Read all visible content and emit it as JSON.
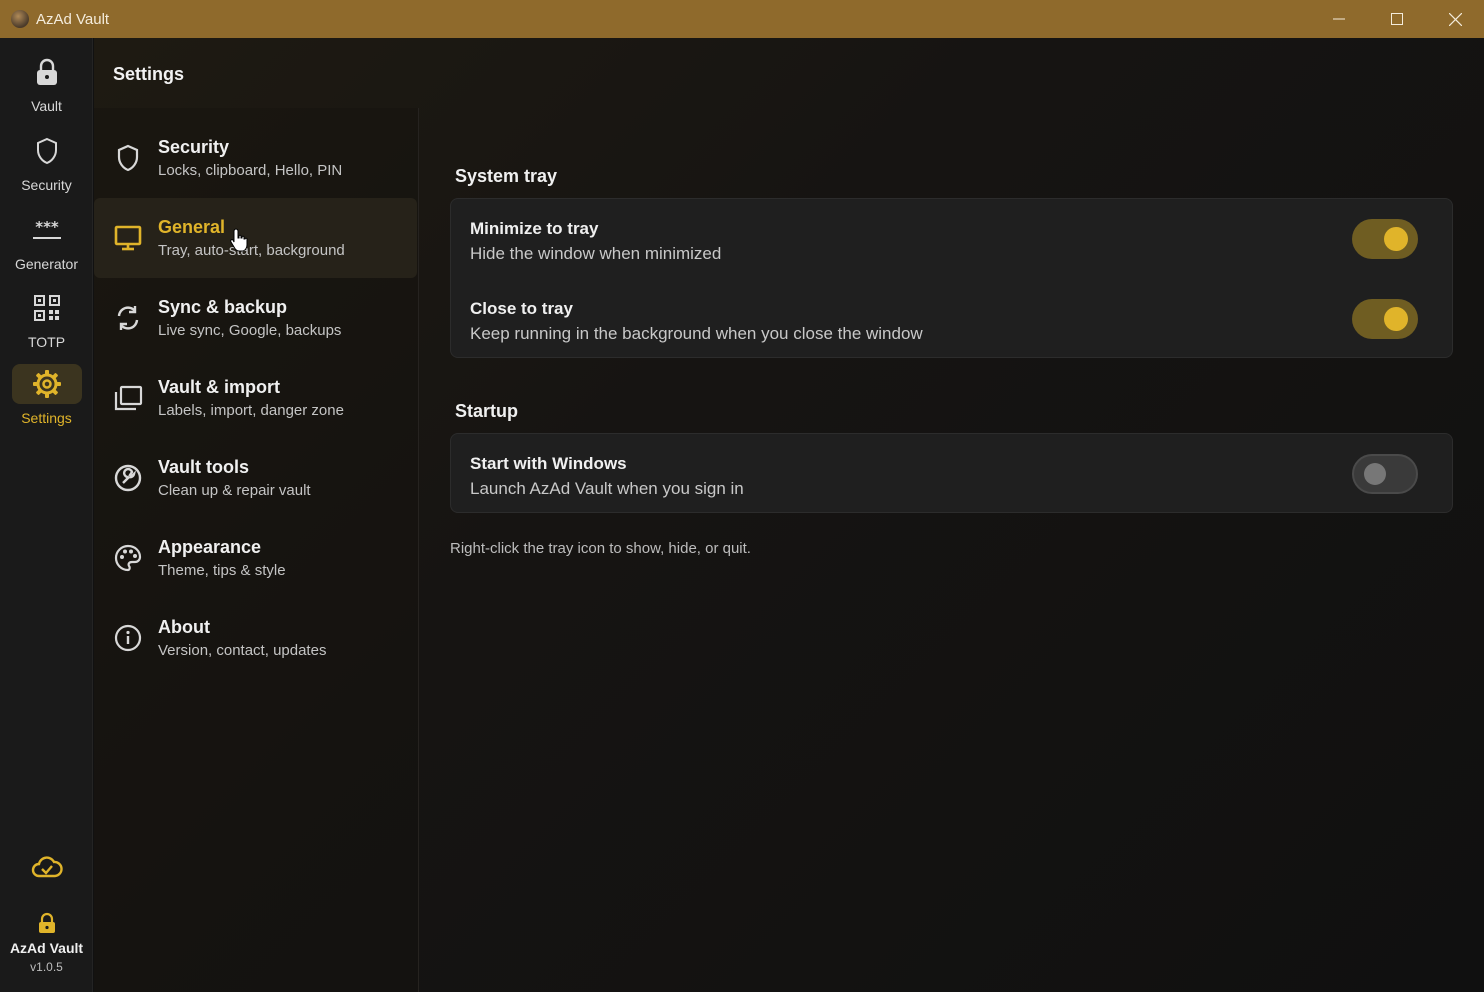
{
  "window": {
    "title": "AzAd Vault"
  },
  "rail": {
    "items": [
      {
        "label": "Vault",
        "icon": "lock-icon"
      },
      {
        "label": "Security",
        "icon": "shield-icon"
      },
      {
        "label": "Generator",
        "icon": "asterisks-icon"
      },
      {
        "label": "TOTP",
        "icon": "qr-code-icon"
      },
      {
        "label": "Settings",
        "icon": "gear-icon",
        "active": true
      }
    ],
    "footer": {
      "name": "AzAd Vault",
      "version": "v1.0.5"
    }
  },
  "page": {
    "title": "Settings"
  },
  "nav": {
    "items": [
      {
        "title": "Security",
        "subtitle": "Locks, clipboard, Hello, PIN",
        "icon": "shield-icon"
      },
      {
        "title": "General",
        "subtitle": "Tray, auto-start, background",
        "icon": "monitor-icon",
        "active": true
      },
      {
        "title": "Sync & backup",
        "subtitle": "Live sync, Google, backups",
        "icon": "sync-icon"
      },
      {
        "title": "Vault & import",
        "subtitle": "Labels, import, danger zone",
        "icon": "folders-icon"
      },
      {
        "title": "Vault tools",
        "subtitle": "Clean up & repair vault",
        "icon": "wrench-icon"
      },
      {
        "title": "Appearance",
        "subtitle": "Theme, tips & style",
        "icon": "palette-icon"
      },
      {
        "title": "About",
        "subtitle": "Version, contact, updates",
        "icon": "info-icon"
      }
    ]
  },
  "content": {
    "tray": {
      "title": "System tray",
      "rows": [
        {
          "title": "Minimize to tray",
          "desc": "Hide the window when minimized",
          "on": true
        },
        {
          "title": "Close to tray",
          "desc": "Keep running in the background when you close the window",
          "on": true
        }
      ]
    },
    "startup": {
      "title": "Startup",
      "rows": [
        {
          "title": "Start with Windows",
          "desc": "Launch AzAd Vault when you sign in",
          "on": false
        }
      ]
    },
    "hint": "Right-click the tray icon to show, hide, or quit."
  },
  "colors": {
    "accent": "#e0b42a",
    "titlebar": "#8f6a2c"
  }
}
